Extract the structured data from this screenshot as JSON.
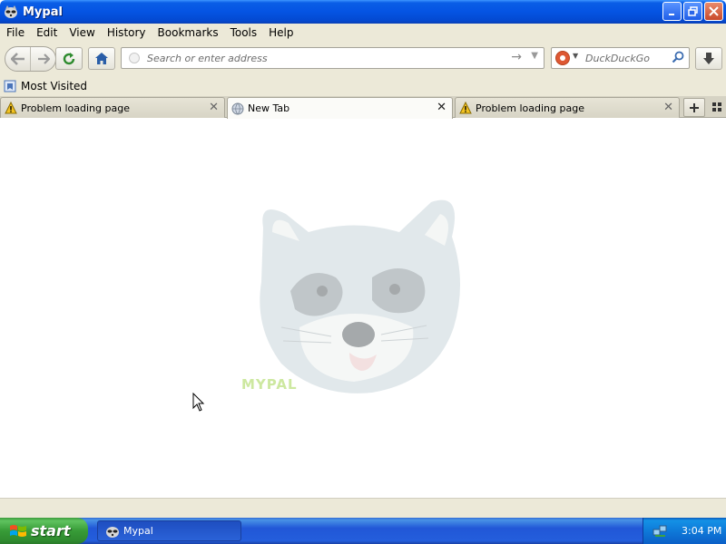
{
  "window": {
    "title": "Mypal"
  },
  "menubar": {
    "items": [
      "File",
      "Edit",
      "View",
      "History",
      "Bookmarks",
      "Tools",
      "Help"
    ]
  },
  "navbar": {
    "url_placeholder": "Search or enter address",
    "search_placeholder": "DuckDuckGo",
    "search_engine_icon": "duckduckgo-icon"
  },
  "bookmarks": {
    "items": [
      {
        "label": "Most Visited",
        "icon": "bookmarks-folder-icon"
      }
    ]
  },
  "tabs": [
    {
      "label": "Problem loading page",
      "icon": "warning-icon",
      "active": false
    },
    {
      "label": "New Tab",
      "icon": "globe-icon",
      "active": true
    },
    {
      "label": "Problem loading page",
      "icon": "warning-icon",
      "active": false
    }
  ],
  "content": {
    "watermark_text": "MYPAL"
  },
  "taskbar": {
    "start_label": "start",
    "tasks": [
      {
        "label": "Mypal"
      }
    ],
    "clock": "3:04 PM"
  },
  "colors": {
    "xp_blue": "#0554e3",
    "start_green": "#379b37",
    "chrome_beige": "#ece9d8",
    "watermark_green": "#cde8a0"
  }
}
